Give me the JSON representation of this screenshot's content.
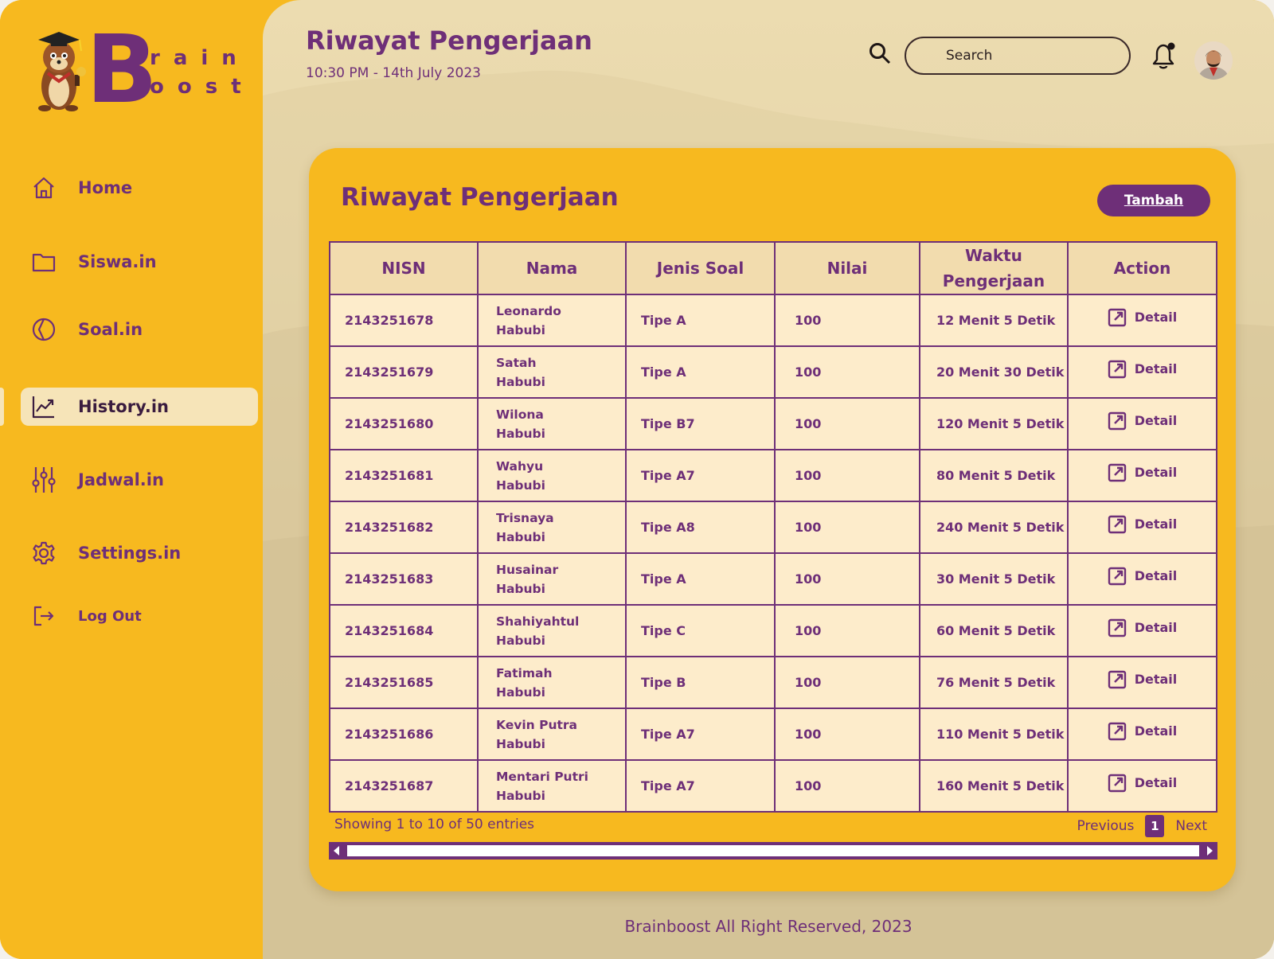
{
  "brand": {
    "letter": "B",
    "row1": "rain",
    "row2": "oost"
  },
  "sidebar": {
    "items": [
      {
        "label": "Home",
        "icon": "home-icon",
        "active": false
      },
      {
        "label": "Siswa.in",
        "icon": "folder-icon",
        "active": false
      },
      {
        "label": "Soal.in",
        "icon": "pie-chart-icon",
        "active": false
      },
      {
        "label": "History.in",
        "icon": "trend-chart-icon",
        "active": true
      },
      {
        "label": "Jadwal.in",
        "icon": "sliders-icon",
        "active": false
      },
      {
        "label": "Settings.in",
        "icon": "gear-icon",
        "active": false
      },
      {
        "label": "Log Out",
        "icon": "logout-icon",
        "active": false
      }
    ]
  },
  "header": {
    "title": "Riwayat Pengerjaan",
    "datetime": "10:30 PM - 14th July 2023",
    "search_placeholder": "Search"
  },
  "card": {
    "title": "Riwayat Pengerjaan",
    "add_label": "Tambah"
  },
  "table": {
    "columns": [
      "NISN",
      "Nama",
      "Jenis Soal",
      "Nilai",
      "Waktu Pengerjaan",
      "Action"
    ],
    "rows": [
      {
        "nisn": "2143251678",
        "nama1": "Leonardo",
        "nama2": "Habubi",
        "jenis": "Tipe A",
        "nilai": "100",
        "waktu": "12 Menit 5 Detik",
        "action": "Detail"
      },
      {
        "nisn": "2143251679",
        "nama1": "Satah",
        "nama2": "Habubi",
        "jenis": "Tipe A",
        "nilai": "100",
        "waktu": "20 Menit 30 Detik",
        "action": "Detail"
      },
      {
        "nisn": "2143251680",
        "nama1": "Wilona",
        "nama2": "Habubi",
        "jenis": "Tipe B7",
        "nilai": "100",
        "waktu": "120 Menit 5 Detik",
        "action": "Detail"
      },
      {
        "nisn": "2143251681",
        "nama1": "Wahyu",
        "nama2": "Habubi",
        "jenis": "Tipe A7",
        "nilai": "100",
        "waktu": "80 Menit 5 Detik",
        "action": "Detail"
      },
      {
        "nisn": "2143251682",
        "nama1": "Trisnaya",
        "nama2": "Habubi",
        "jenis": "Tipe A8",
        "nilai": "100",
        "waktu": "240 Menit 5 Detik",
        "action": "Detail"
      },
      {
        "nisn": "2143251683",
        "nama1": "Husainar",
        "nama2": "Habubi",
        "jenis": "Tipe A",
        "nilai": "100",
        "waktu": "30 Menit 5 Detik",
        "action": "Detail"
      },
      {
        "nisn": "2143251684",
        "nama1": "Shahiyahtul",
        "nama2": "Habubi",
        "jenis": "Tipe C",
        "nilai": "100",
        "waktu": "60 Menit 5 Detik",
        "action": "Detail"
      },
      {
        "nisn": "2143251685",
        "nama1": "Fatimah",
        "nama2": "Habubi",
        "jenis": "Tipe B",
        "nilai": "100",
        "waktu": "76 Menit 5 Detik",
        "action": "Detail"
      },
      {
        "nisn": "2143251686",
        "nama1": "Kevin Putra",
        "nama2": "Habubi",
        "jenis": "Tipe A7",
        "nilai": "100",
        "waktu": "110 Menit 5 Detik",
        "action": "Detail"
      },
      {
        "nisn": "2143251687",
        "nama1": "Mentari Putri",
        "nama2": "Habubi",
        "jenis": "Tipe A7",
        "nilai": "100",
        "waktu": "160 Menit 5 Detik",
        "action": "Detail"
      }
    ]
  },
  "pagination": {
    "info": "Showing 1 to 10 of 50 entries",
    "previous": "Previous",
    "current": "1",
    "next": "Next"
  },
  "footer": "Brainboost All Right Reserved, 2023",
  "colors": {
    "primary": "#6e2f78",
    "accent": "#f7b91f",
    "row_bg": "#fdeccb",
    "header_bg": "#f2dcae",
    "active_nav": "#f6e4b8"
  }
}
